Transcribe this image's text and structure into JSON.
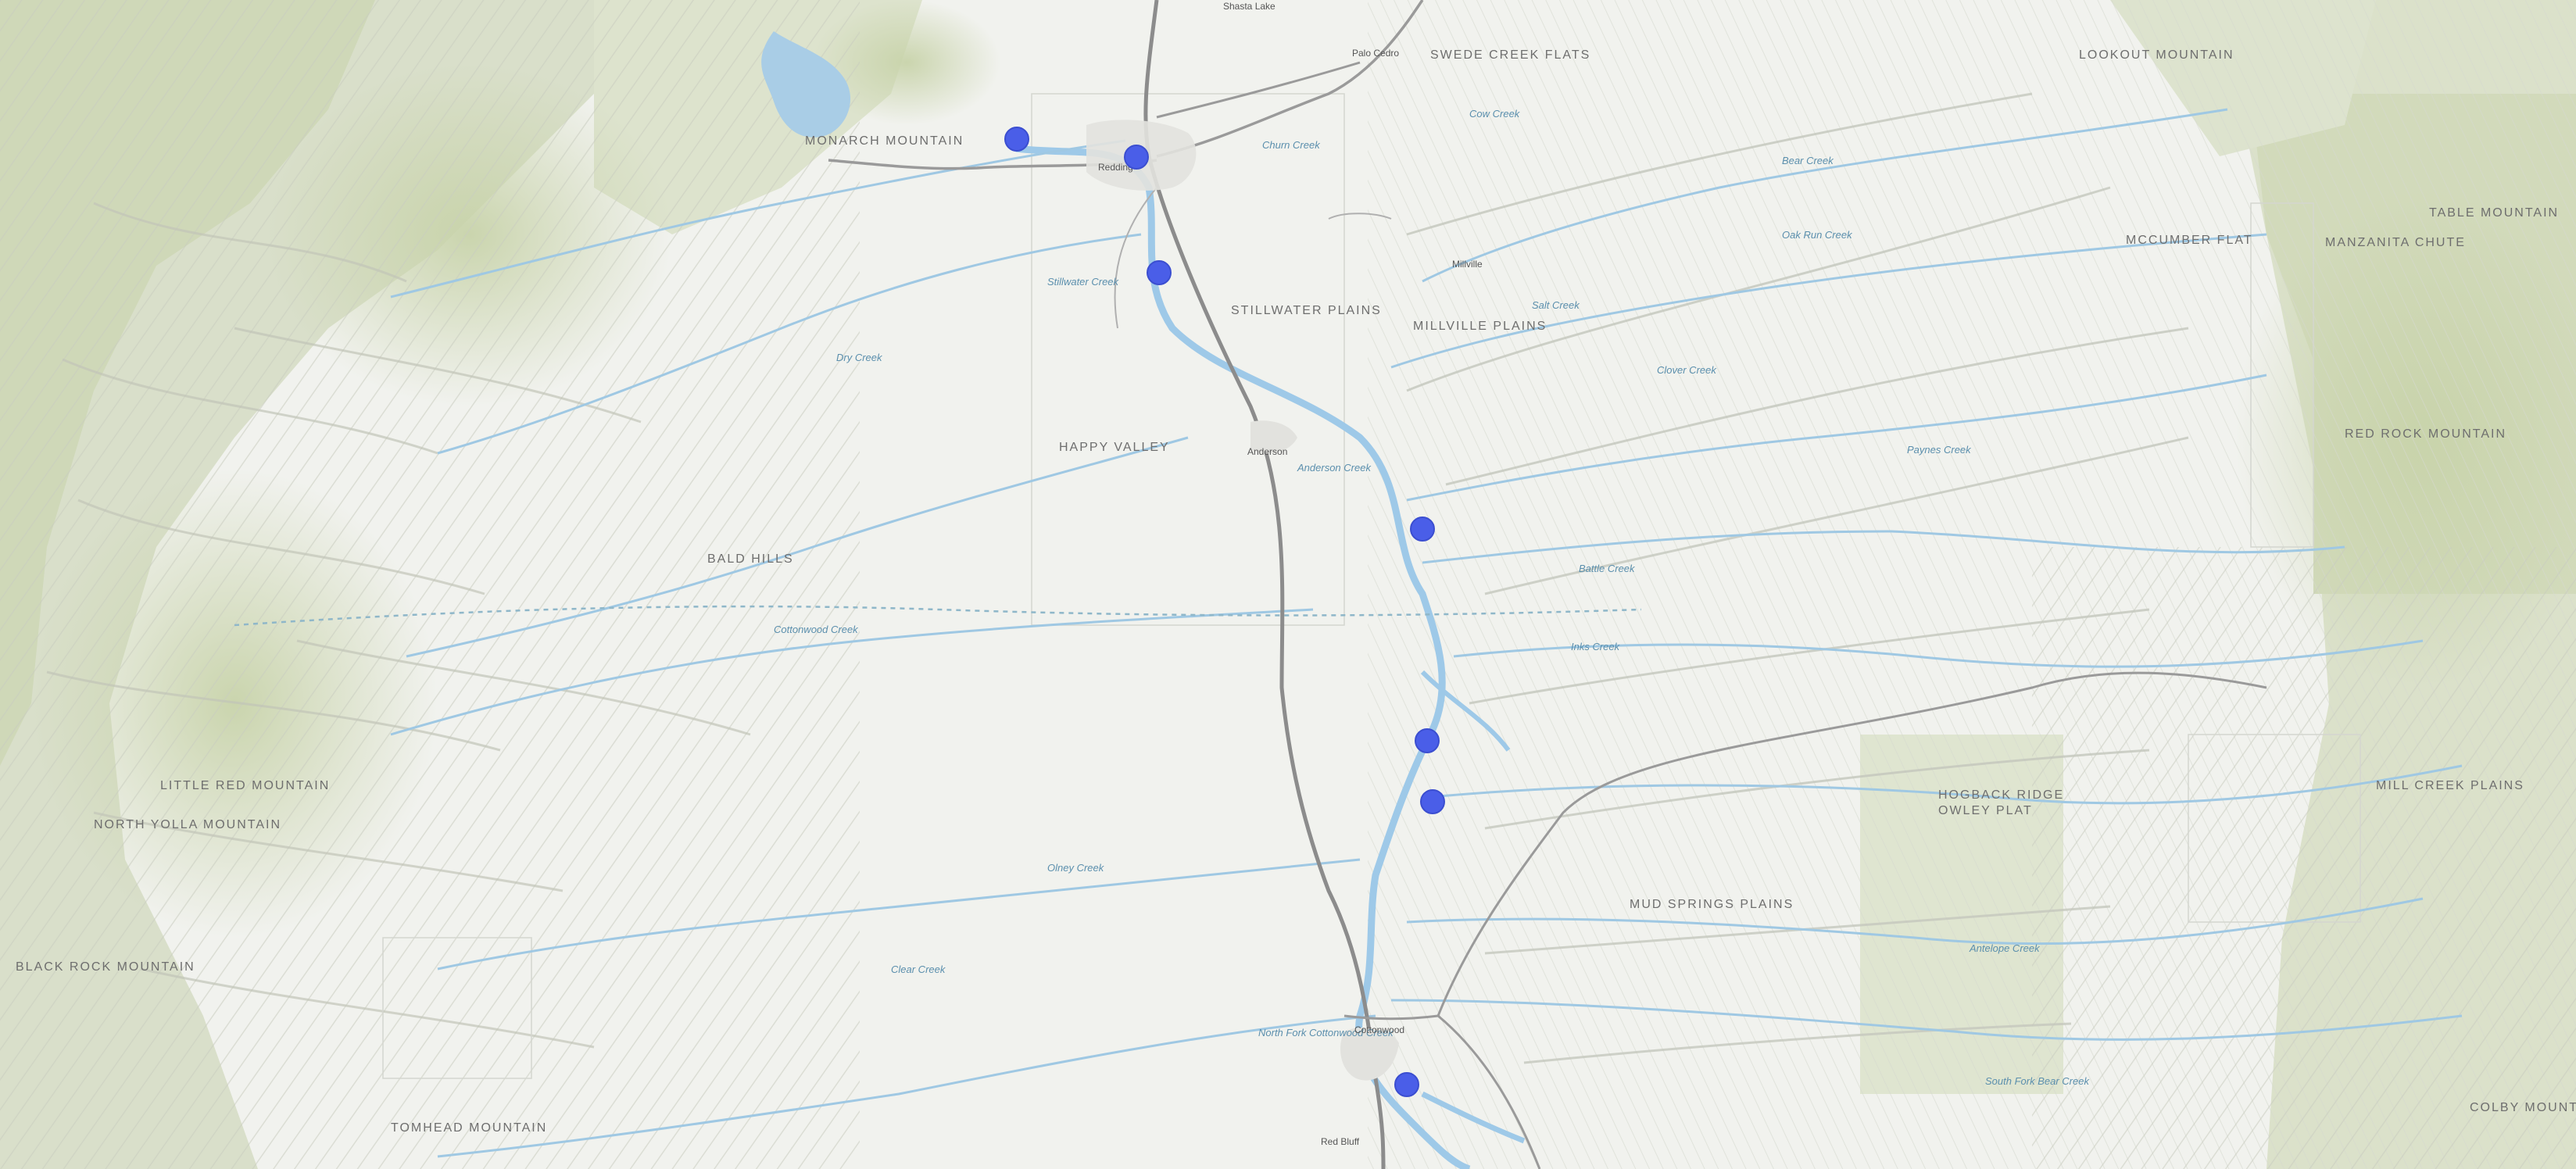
{
  "map": {
    "basemap": "topographic",
    "marker_color": "#4a5ee8",
    "markers": [
      {
        "id": 1
      },
      {
        "id": 2
      },
      {
        "id": 3
      },
      {
        "id": 4
      },
      {
        "id": 5
      },
      {
        "id": 6
      },
      {
        "id": 7
      }
    ],
    "region_labels": [
      "SWEDE CREEK FLATS",
      "STILLWATER PLAINS",
      "MILLVILLE PLAINS",
      "HAPPY VALLEY",
      "BALD HILLS",
      "LITTLE RED MOUNTAIN",
      "NORTH YOLLA MOUNTAIN",
      "BLACK ROCK MOUNTAIN",
      "TOMHEAD MOUNTAIN",
      "HOGBACK RIDGE",
      "OWLEY PLAT",
      "MUD SPRINGS PLAINS",
      "RED ROCK MOUNTAIN",
      "MANZANITA CHUTE",
      "TABLE MOUNTAIN",
      "MILL CREEK PLAINS",
      "COLBY MOUNTAIN",
      "MCCUMBER FLAT",
      "MONARCH MOUNTAIN",
      "LOOKOUT MOUNTAIN"
    ],
    "water_labels": [
      "Cow Creek",
      "Bear Creek",
      "Dry Creek",
      "Cottonwood Creek",
      "Battle Creek",
      "Inks Creek",
      "Paynes Creek",
      "Antelope Creek",
      "Olney Creek",
      "Anderson Creek",
      "Clear Creek",
      "Salt Creek",
      "Oak Run Creek",
      "Clover Creek",
      "Churn Creek",
      "Stillwater Creek",
      "North Fork Cottonwood Creek",
      "South Fork Bear Creek"
    ],
    "places": [
      "Redding",
      "Anderson",
      "Cottonwood",
      "Red Bluff",
      "Palo Cedro",
      "Millville",
      "Shasta Lake"
    ]
  }
}
